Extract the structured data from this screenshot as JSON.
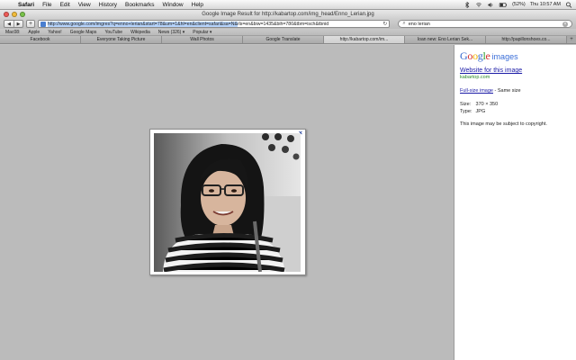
{
  "menubar": {
    "app": "Safari",
    "items": [
      "File",
      "Edit",
      "View",
      "History",
      "Bookmarks",
      "Window",
      "Help"
    ],
    "battery": "(52%)",
    "clock": "Thu 10:57 AM"
  },
  "window": {
    "title": "Google Image Result for http://kabartop.com/img_head/Enno_Lerian.jpg"
  },
  "toolbar": {
    "back_icon": "back-arrow-icon",
    "forward_icon": "forward-arrow-icon",
    "url_selected": "http://www.google.com/imgres?q=enno+lerian&start=78&um=1&hl=en&client=safari&sa=N&",
    "url_rest": "rls=en&biw=1435&bih=780&tbm=isch&tbnid",
    "search_value": "eno lerian"
  },
  "bookmarks": [
    "Mac08:",
    "Apple",
    "Yahoo!",
    "Google Maps",
    "YouTube",
    "Wikipedia",
    "News (326) ▾",
    "Popular ▾"
  ],
  "tabs": [
    {
      "label": "Facebook",
      "active": false
    },
    {
      "label": "Everyone Taking Picture",
      "active": false
    },
    {
      "label": "Wall Photos",
      "active": false
    },
    {
      "label": "Google Translate",
      "active": false
    },
    {
      "label": "http://kabartop.com/im...",
      "active": true
    },
    {
      "label": "Ioan new: Eno Lerian Sek...",
      "active": false
    },
    {
      "label": "http://papillonshoes.co...",
      "active": false
    }
  ],
  "image_panel": {
    "close_label": "×"
  },
  "sidebar": {
    "logo_word": "Google",
    "logo_sub": "images",
    "website_link": "Website for this image",
    "domain": "kabartop.com",
    "fullsize_link": "Full-size image",
    "fullsize_suffix": " - Same size",
    "size_label": "Size:",
    "size_value": "370 × 350",
    "type_label": "Type:",
    "type_value": "JPG",
    "note": "This image may be subject to copyright."
  }
}
